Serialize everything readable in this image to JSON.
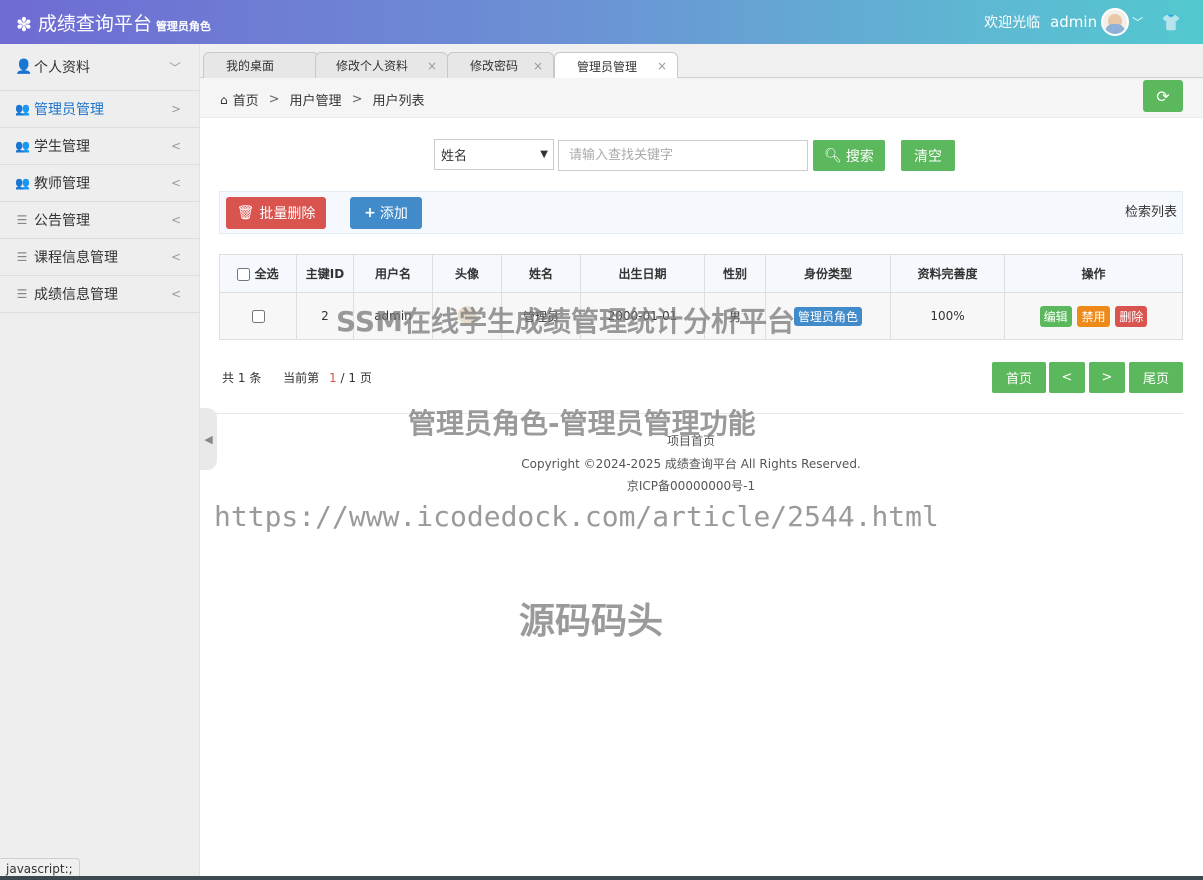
{
  "header": {
    "title": "成绩查询平台",
    "role": "管理员角色",
    "welcome": "欢迎光临",
    "username": "admin",
    "icons": [
      "gear-icon",
      "avatar",
      "chevron-down-icon",
      "shirt-icon"
    ]
  },
  "sidebar": {
    "items": [
      {
        "label": "个人资料",
        "icon": "user-icon",
        "arrow": "﹀"
      },
      {
        "label": "管理员管理",
        "icon": "users-icon",
        "arrow": ">"
      },
      {
        "label": "学生管理",
        "icon": "users-icon",
        "arrow": "<"
      },
      {
        "label": "教师管理",
        "icon": "users-icon",
        "arrow": "<"
      },
      {
        "label": "公告管理",
        "icon": "list-icon",
        "arrow": "<"
      },
      {
        "label": "课程信息管理",
        "icon": "list-icon",
        "arrow": "<"
      },
      {
        "label": "成绩信息管理",
        "icon": "list-icon",
        "arrow": "<"
      }
    ]
  },
  "tabs": [
    {
      "label": "我的桌面"
    },
    {
      "label": "修改个人资料",
      "close": "×"
    },
    {
      "label": "修改密码",
      "close": "×"
    },
    {
      "label": "管理员管理",
      "close": "×"
    }
  ],
  "breadcrumb": {
    "home": "首页",
    "sep": ">",
    "level1": "用户管理",
    "level2": "用户列表"
  },
  "search": {
    "field": "姓名",
    "placeholder": "请输入查找关键字",
    "search_label": "搜索",
    "clear_label": "清空"
  },
  "toolbar": {
    "batch_delete": "批量删除",
    "add": "添加",
    "list_label": "检索列表"
  },
  "table": {
    "headers": [
      "全选",
      "主键ID",
      "用户名",
      "头像",
      "姓名",
      "出生日期",
      "性别",
      "身份类型",
      "资料完善度",
      "操作"
    ],
    "rows": [
      {
        "id": "2",
        "username": "admin",
        "name": "管理员",
        "birth": "2000-01-01",
        "gender": "男",
        "role": "管理员角色",
        "completeness": "100%"
      }
    ],
    "ops": {
      "edit": "编辑",
      "ban": "禁用",
      "del": "删除"
    }
  },
  "pager": {
    "total_prefix": "共",
    "total": "1",
    "total_suffix": "条",
    "current_prefix": "当前第",
    "current": "1",
    "current_mid": "/",
    "pages": "1",
    "current_suffix": "页",
    "first": "首页",
    "prev": "<",
    "next": ">",
    "last": "尾页"
  },
  "footer": {
    "home": "项目首页",
    "copyright": "Copyright ©2024-2025 成绩查询平台 All Rights Reserved.",
    "icp": "京ICP备00000000号-1"
  },
  "watermarks": {
    "w1": "SSM在线学生成绩管理统计分析平台",
    "w2": "管理员角色-管理员管理功能",
    "w3": "https://www.icodedock.com/article/2544.html",
    "w4": "源码码头"
  },
  "status_bar": "javascript:;",
  "colors": {
    "green": "#5cb85c",
    "blue": "#428bca",
    "red": "#d9534f",
    "orange": "#ed8a19"
  }
}
